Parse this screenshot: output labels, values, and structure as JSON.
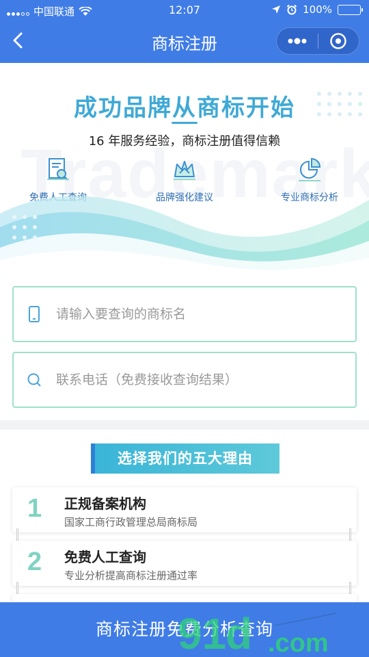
{
  "status": {
    "carrier": "中国联通",
    "time": "12:07",
    "battery": "100%"
  },
  "nav": {
    "title": "商标注册"
  },
  "hero": {
    "title": "成功品牌从商标开始",
    "subtitle": "16 年服务经验，商标注册值得信赖",
    "watermark": "Trademark",
    "features": [
      {
        "label": "免费人工查询",
        "icon": "search-document-icon"
      },
      {
        "label": "品牌强化建议",
        "icon": "crown-icon"
      },
      {
        "label": "专业商标分析",
        "icon": "pie-chart-icon"
      }
    ]
  },
  "form": {
    "name_placeholder": "请输入要查询的商标名",
    "phone_placeholder": "联系电话（免费接收查询结果）"
  },
  "reasons": {
    "heading": "选择我们的五大理由",
    "items": [
      {
        "num": "1",
        "title": "正规备案机构",
        "desc": "国家工商行政管理总局商标局"
      },
      {
        "num": "2",
        "title": "免费人工查询",
        "desc": "专业分析提高商标注册通过率"
      }
    ]
  },
  "cta": {
    "label": "商标注册免费分析查询"
  },
  "colors": {
    "primary": "#3f7ce6",
    "accent": "#3fa9d6",
    "border": "#9fe0cc"
  }
}
